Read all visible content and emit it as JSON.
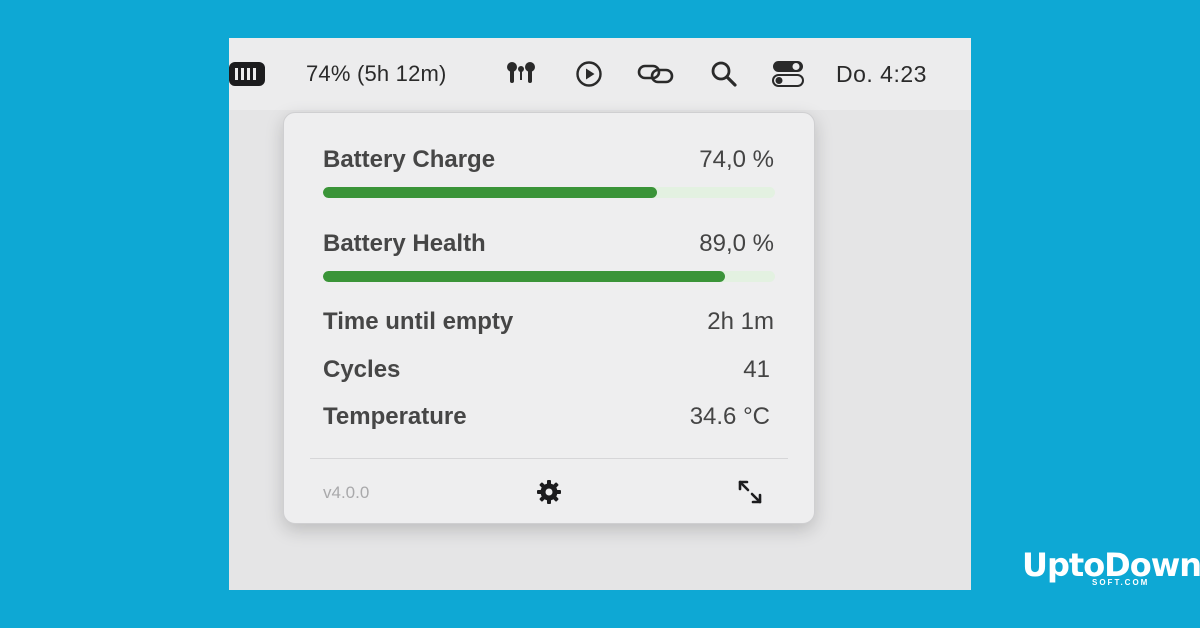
{
  "menubar": {
    "battery_text": "74% (5h 12m)",
    "clock": "Do. 4:23",
    "icons": [
      "battery-icon",
      "airpods-icon",
      "play-circle-icon",
      "link-icon",
      "search-icon",
      "control-center-icon"
    ]
  },
  "popover": {
    "charge": {
      "label": "Battery Charge",
      "value": "74,0 %",
      "level": 0.74
    },
    "health": {
      "label": "Battery Health",
      "value": "89,0 %",
      "level": 0.89
    },
    "time_until_empty": {
      "label": "Time until empty",
      "value": "2h 1m"
    },
    "cycles": {
      "label": "Cycles",
      "value": "41"
    },
    "temperature": {
      "label": "Temperature",
      "value": "34.6 °C"
    },
    "footer": {
      "version": "v4.0.0",
      "icons": [
        "gear-icon",
        "expand-icon"
      ]
    }
  },
  "brand": {
    "main": "UptoDown",
    "sub": "SOFT.COM"
  },
  "colors": {
    "background": "#0ea8d4",
    "bar_fill": "#3a9438",
    "bar_track": "#e3f1e1"
  }
}
